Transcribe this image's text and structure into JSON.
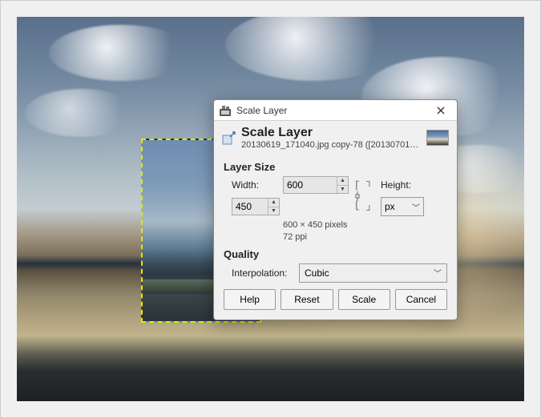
{
  "window": {
    "title": "Scale Layer"
  },
  "header": {
    "title": "Scale Layer",
    "subtitle": "20130619_171040.jpg copy-78 ([20130701_..."
  },
  "sections": {
    "size_heading": "Layer Size",
    "quality_heading": "Quality"
  },
  "size": {
    "width_label": "Width:",
    "height_label": "Height:",
    "width_value": "600",
    "height_value": "450",
    "unit": "px",
    "info_dims": "600 × 450 pixels",
    "info_ppi": "72 ppi"
  },
  "quality": {
    "interp_label": "Interpolation:",
    "interp_value": "Cubic"
  },
  "buttons": {
    "help": "Help",
    "reset": "Reset",
    "scale": "Scale",
    "cancel": "Cancel"
  },
  "colors": {
    "accent": "#e6e600"
  }
}
